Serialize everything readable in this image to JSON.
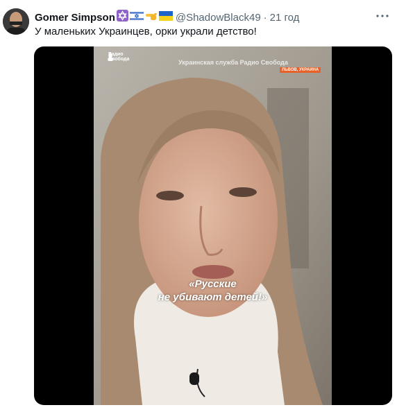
{
  "tweet": {
    "author_name": "Gomer Simpson",
    "handle": "@ShadowBlack49",
    "separator": "·",
    "time": "21 год",
    "text": "У маленьких Украинцев, орки украли детство!",
    "flags": [
      "star-of-david-icon",
      "israel-flag-icon",
      "pointing-hand-icon",
      "ukraine-flag-icon"
    ],
    "more_label": "···"
  },
  "video": {
    "logo_text": "Радио Свобода",
    "service_title": "Украинская служба Радио Свобода",
    "location_badge": "ЛЬВОВ, УКРАИНА",
    "caption_line1": "«Русские",
    "caption_line2": "не убивают детей!»"
  },
  "colors": {
    "text_primary": "#0f1419",
    "text_secondary": "#536471",
    "media_background": "#000000",
    "badge_orange": "#e8612a"
  }
}
